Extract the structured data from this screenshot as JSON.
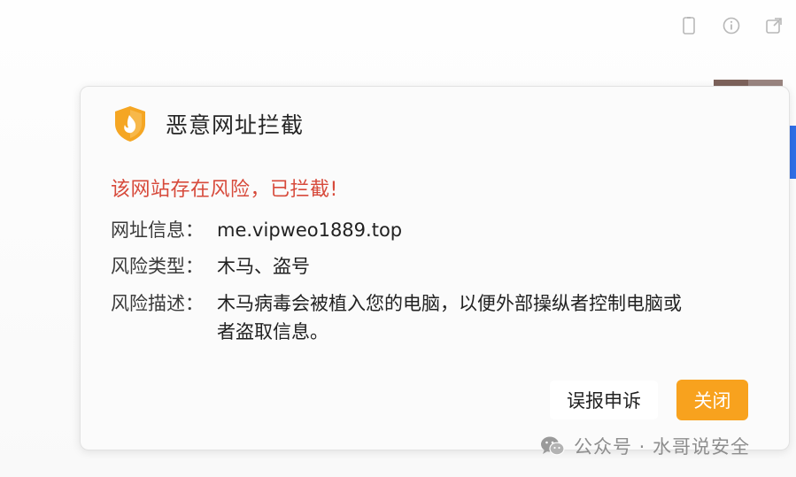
{
  "toolbar": {
    "icons": [
      "clipboard-icon",
      "info-icon",
      "share-icon"
    ]
  },
  "dialog": {
    "title": "恶意网址拦截",
    "warning": "该网站存在风险，已拦截!",
    "url": {
      "label": "网址信息：",
      "value": "me.vipweo1889.top"
    },
    "risk_type": {
      "label": "风险类型：",
      "value": "木马、盗号"
    },
    "risk_desc": {
      "label": "风险描述：",
      "value": "木马病毒会被植入您的电脑，以便外部操纵者控制电脑或者盗取信息。"
    },
    "buttons": {
      "appeal": "误报申诉",
      "close": "关闭"
    }
  },
  "watermark": {
    "text": "公众号 · 水哥说安全"
  },
  "colors": {
    "warning": "#d74a3b",
    "close_button": "#f8a21e",
    "shield_orange": "#f5a623"
  }
}
